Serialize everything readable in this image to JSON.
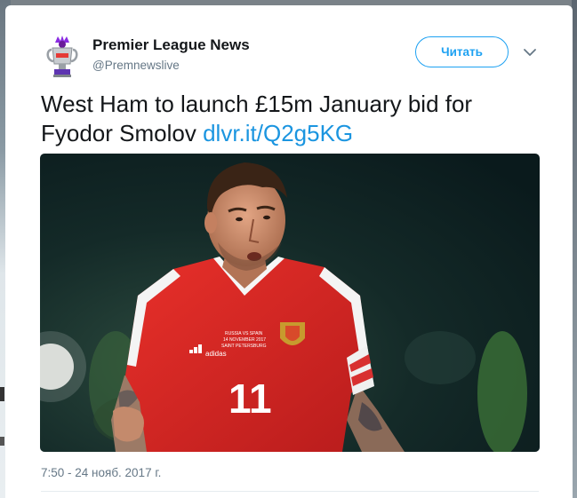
{
  "account": {
    "display_name": "Premier League News",
    "handle": "@Premnewslive",
    "avatar_icon": "premier-league-trophy-icon"
  },
  "follow_button": {
    "label": "Читать"
  },
  "menu": {
    "icon": "chevron-down-icon"
  },
  "tweet": {
    "text": "West Ham to launch £15m January bid for Fyodor Smolov ",
    "link": "dlvr.it/Q2g5KG",
    "timestamp": "7:50 - 24 нояб. 2017 г."
  },
  "media": {
    "shirt_number": "11",
    "shirt_brand": "adidas",
    "shirt_text": "RUSSIA VS SPAIN 14 NOVEMBER 2017 SAINT PETERSBURG"
  },
  "colors": {
    "accent": "#1da1f2",
    "link": "#1b95e0",
    "text": "#14171a",
    "muted": "#657786"
  }
}
